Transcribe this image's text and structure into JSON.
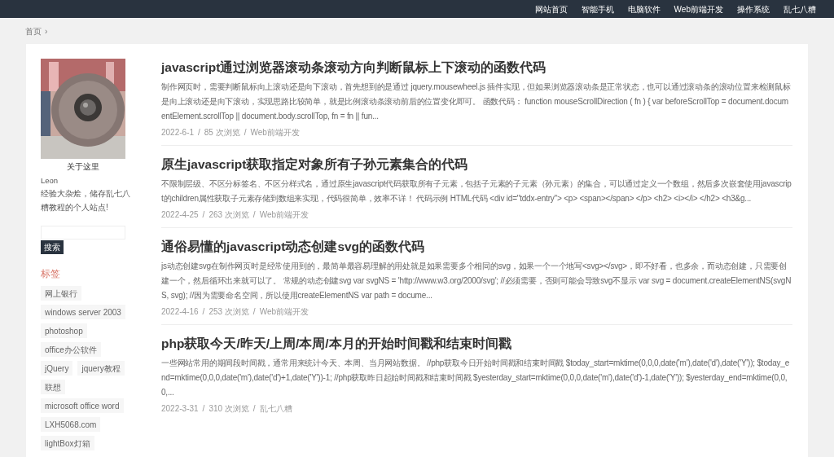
{
  "nav": [
    {
      "label": "网站首页"
    },
    {
      "label": "智能手机"
    },
    {
      "label": "电脑软件"
    },
    {
      "label": "Web前端开发"
    },
    {
      "label": "操作系统"
    },
    {
      "label": "乱七八糟"
    }
  ],
  "breadcrumb": {
    "label": "首页",
    "separator": "›"
  },
  "sidebar": {
    "caption": "关于这里",
    "author": "Leon",
    "bio": "经验大杂烩，储存乱七八糟教程的个人站点!",
    "search_button": "搜索",
    "tags_title": "标签",
    "tags": [
      {
        "label": "网上银行"
      },
      {
        "label": "windows server 2003"
      },
      {
        "label": "photoshop"
      },
      {
        "label": "office办公软件"
      },
      {
        "label": "jQuery"
      },
      {
        "label": "jquery教程"
      },
      {
        "label": "联想"
      },
      {
        "label": "microsoft office word"
      },
      {
        "label": "LXH5068.com"
      },
      {
        "label": "lightBox灯箱"
      }
    ]
  },
  "articles": [
    {
      "title": "javascript通过浏览器滚动条滚动方向判断鼠标上下滚动的函数代码",
      "excerpt": "制作网页时，需要判断鼠标向上滚动还是向下滚动，首先想到的是通过 jquery.mousewheel.js 插件实现，但如果浏览器滚动条是正常状态，也可以通过滚动条的滚动位置来检测鼠标是向上滚动还是向下滚动，实现思路比较简单，就是比例滚动条滚动前后的位置变化即可。 函数代码： function mouseScrollDirection ( fn ) { var beforeScrollTop = document.documentElement.scrollTop || document.body.scrollTop, fn = fn || fun...",
      "date": "2022-6-1",
      "views": "85 次浏览",
      "category": "Web前端开发",
      "separators": [
        "/",
        "/"
      ]
    },
    {
      "title": "原生javascript获取指定对象所有子孙元素集合的代码",
      "excerpt": "不限制层级、不区分标签名、不区分样式名，通过原生javascript代码获取所有子元素，包括子元素的子元素（孙元素）的集合，可以通过定义一个数组，然后多次嵌套使用javascript的children属性获取子元素存储到数组来实现，代码很简单，效率不详！ 代码示例 HTML代码 <div id=\"tddx-entry\"> <p> <span></span> </p> <h2> <i></i> </h2> <h3&g...",
      "date": "2022-4-25",
      "views": "263 次浏览",
      "category": "Web前端开发",
      "separators": [
        "/",
        "/"
      ]
    },
    {
      "title": "通俗易懂的javascript动态创建svg的函数代码",
      "excerpt": "js动态创建svg在制作网页时是经常使用到的，最简单最容易理解的用处就是如果需要多个相同的svg，如果一个一个地写<svg></svg>，即不好看，也多余，而动态创建，只需要创建一个，然后循环出来就可以了。 常规的动态创建svg var svgNS = 'http://www.w3.org/2000/svg'; //必须需要，否则可能会导致svg不显示 var svg = document.createElementNS(svgNS, svg); //因为需要命名空间，所以使用createElementNS var path = docume...",
      "date": "2022-4-16",
      "views": "253 次浏览",
      "category": "Web前端开发",
      "separators": [
        "/",
        "/"
      ]
    },
    {
      "title": "php获取今天/昨天/上周/本周/本月的开始时间戳和结束时间戳",
      "excerpt": "一些网站常用的期间段时间戳，通常用来统计今天、本周、当月网站数据。 //php获取今日开始时间戳和结束时间戳 $today_start=mktime(0,0,0,date('m'),date('d'),date('Y')); $today_end=mktime(0,0,0,date('m'),date('d')+1,date('Y'))-1; //php获取昨日起始时间戳和结束时间戳 $yesterday_start=mktime(0,0,0,date('m'),date('d')-1,date('Y')); $yesterday_end=mktime(0,0,0,...",
      "date": "2022-3-31",
      "views": "310 次浏览",
      "category": "乱七八糟",
      "separators": [
        "/",
        "/"
      ]
    }
  ]
}
